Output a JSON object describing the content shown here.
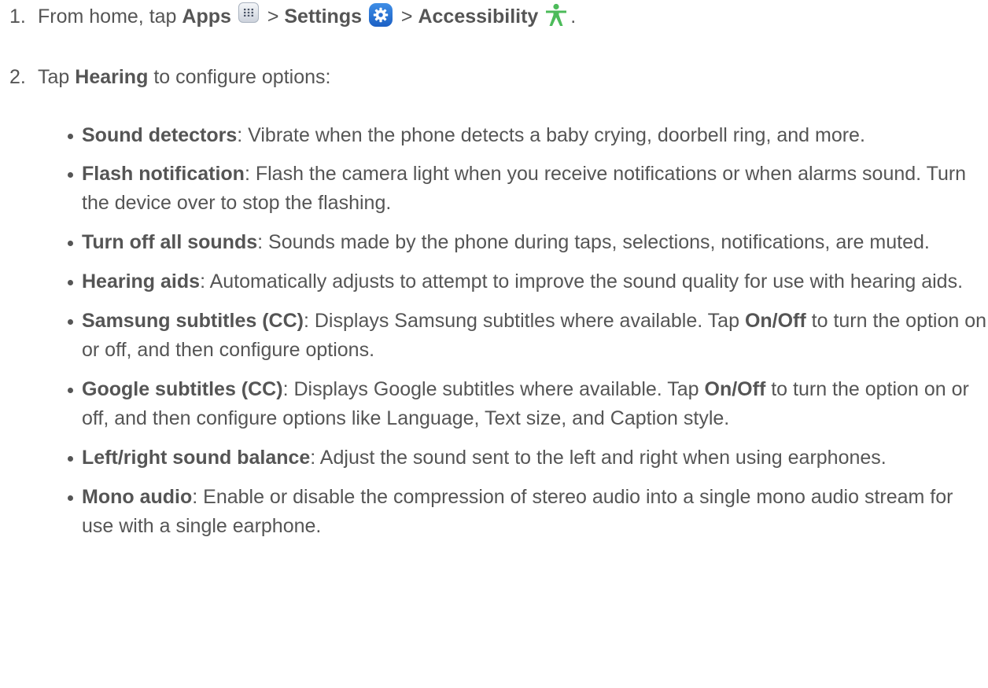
{
  "steps": [
    {
      "number": "1.",
      "prefix": "From home, tap",
      "apps_label": "Apps",
      "sep1": ">",
      "settings_label": "Settings",
      "sep2": ">",
      "accessibility_label": "Accessibility",
      "suffix": "."
    },
    {
      "number": "2.",
      "prefix": "Tap",
      "hearing_label": "Hearing",
      "suffix": "to configure options:"
    }
  ],
  "icons": {
    "apps": "apps-grid-icon",
    "settings": "settings-gear-icon",
    "accessibility": "accessibility-person-icon"
  },
  "colors": {
    "text": "#555555",
    "settings_blue": "#2a74d6",
    "accessibility_green": "#4cbb5a"
  },
  "options": [
    {
      "term": "Sound detectors",
      "desc": ": Vibrate when the phone detects a baby crying, doorbell ring, and more."
    },
    {
      "term": "Flash notification",
      "desc": ": Flash the camera light when you receive notifications or when alarms sound. Turn the device over to stop the flashing."
    },
    {
      "term": "Turn off all sounds",
      "desc": ": Sounds made by the phone during taps, selections, notifications, are muted."
    },
    {
      "term": "Hearing aids",
      "desc": ": Automatically adjusts to attempt to improve the sound quality for use with hearing aids."
    },
    {
      "term": "Samsung subtitles (CC)",
      "desc_a": ": Displays Samsung subtitles where available. Tap",
      "inline_bold": "On/Off",
      "desc_b": "to turn the option on or off, and then configure options."
    },
    {
      "term": "Google subtitles (CC)",
      "desc_a": ": Displays Google subtitles where available. Tap",
      "inline_bold": "On/Off",
      "desc_b": "to turn the option on or off, and then configure options like Language, Text size, and Caption style."
    },
    {
      "term": "Left/right sound balance",
      "desc": ": Adjust the sound sent to the left and right when using earphones."
    },
    {
      "term": "Mono audio",
      "desc": ": Enable or disable the compression of stereo audio into a single mono audio stream for use with a single earphone."
    }
  ]
}
